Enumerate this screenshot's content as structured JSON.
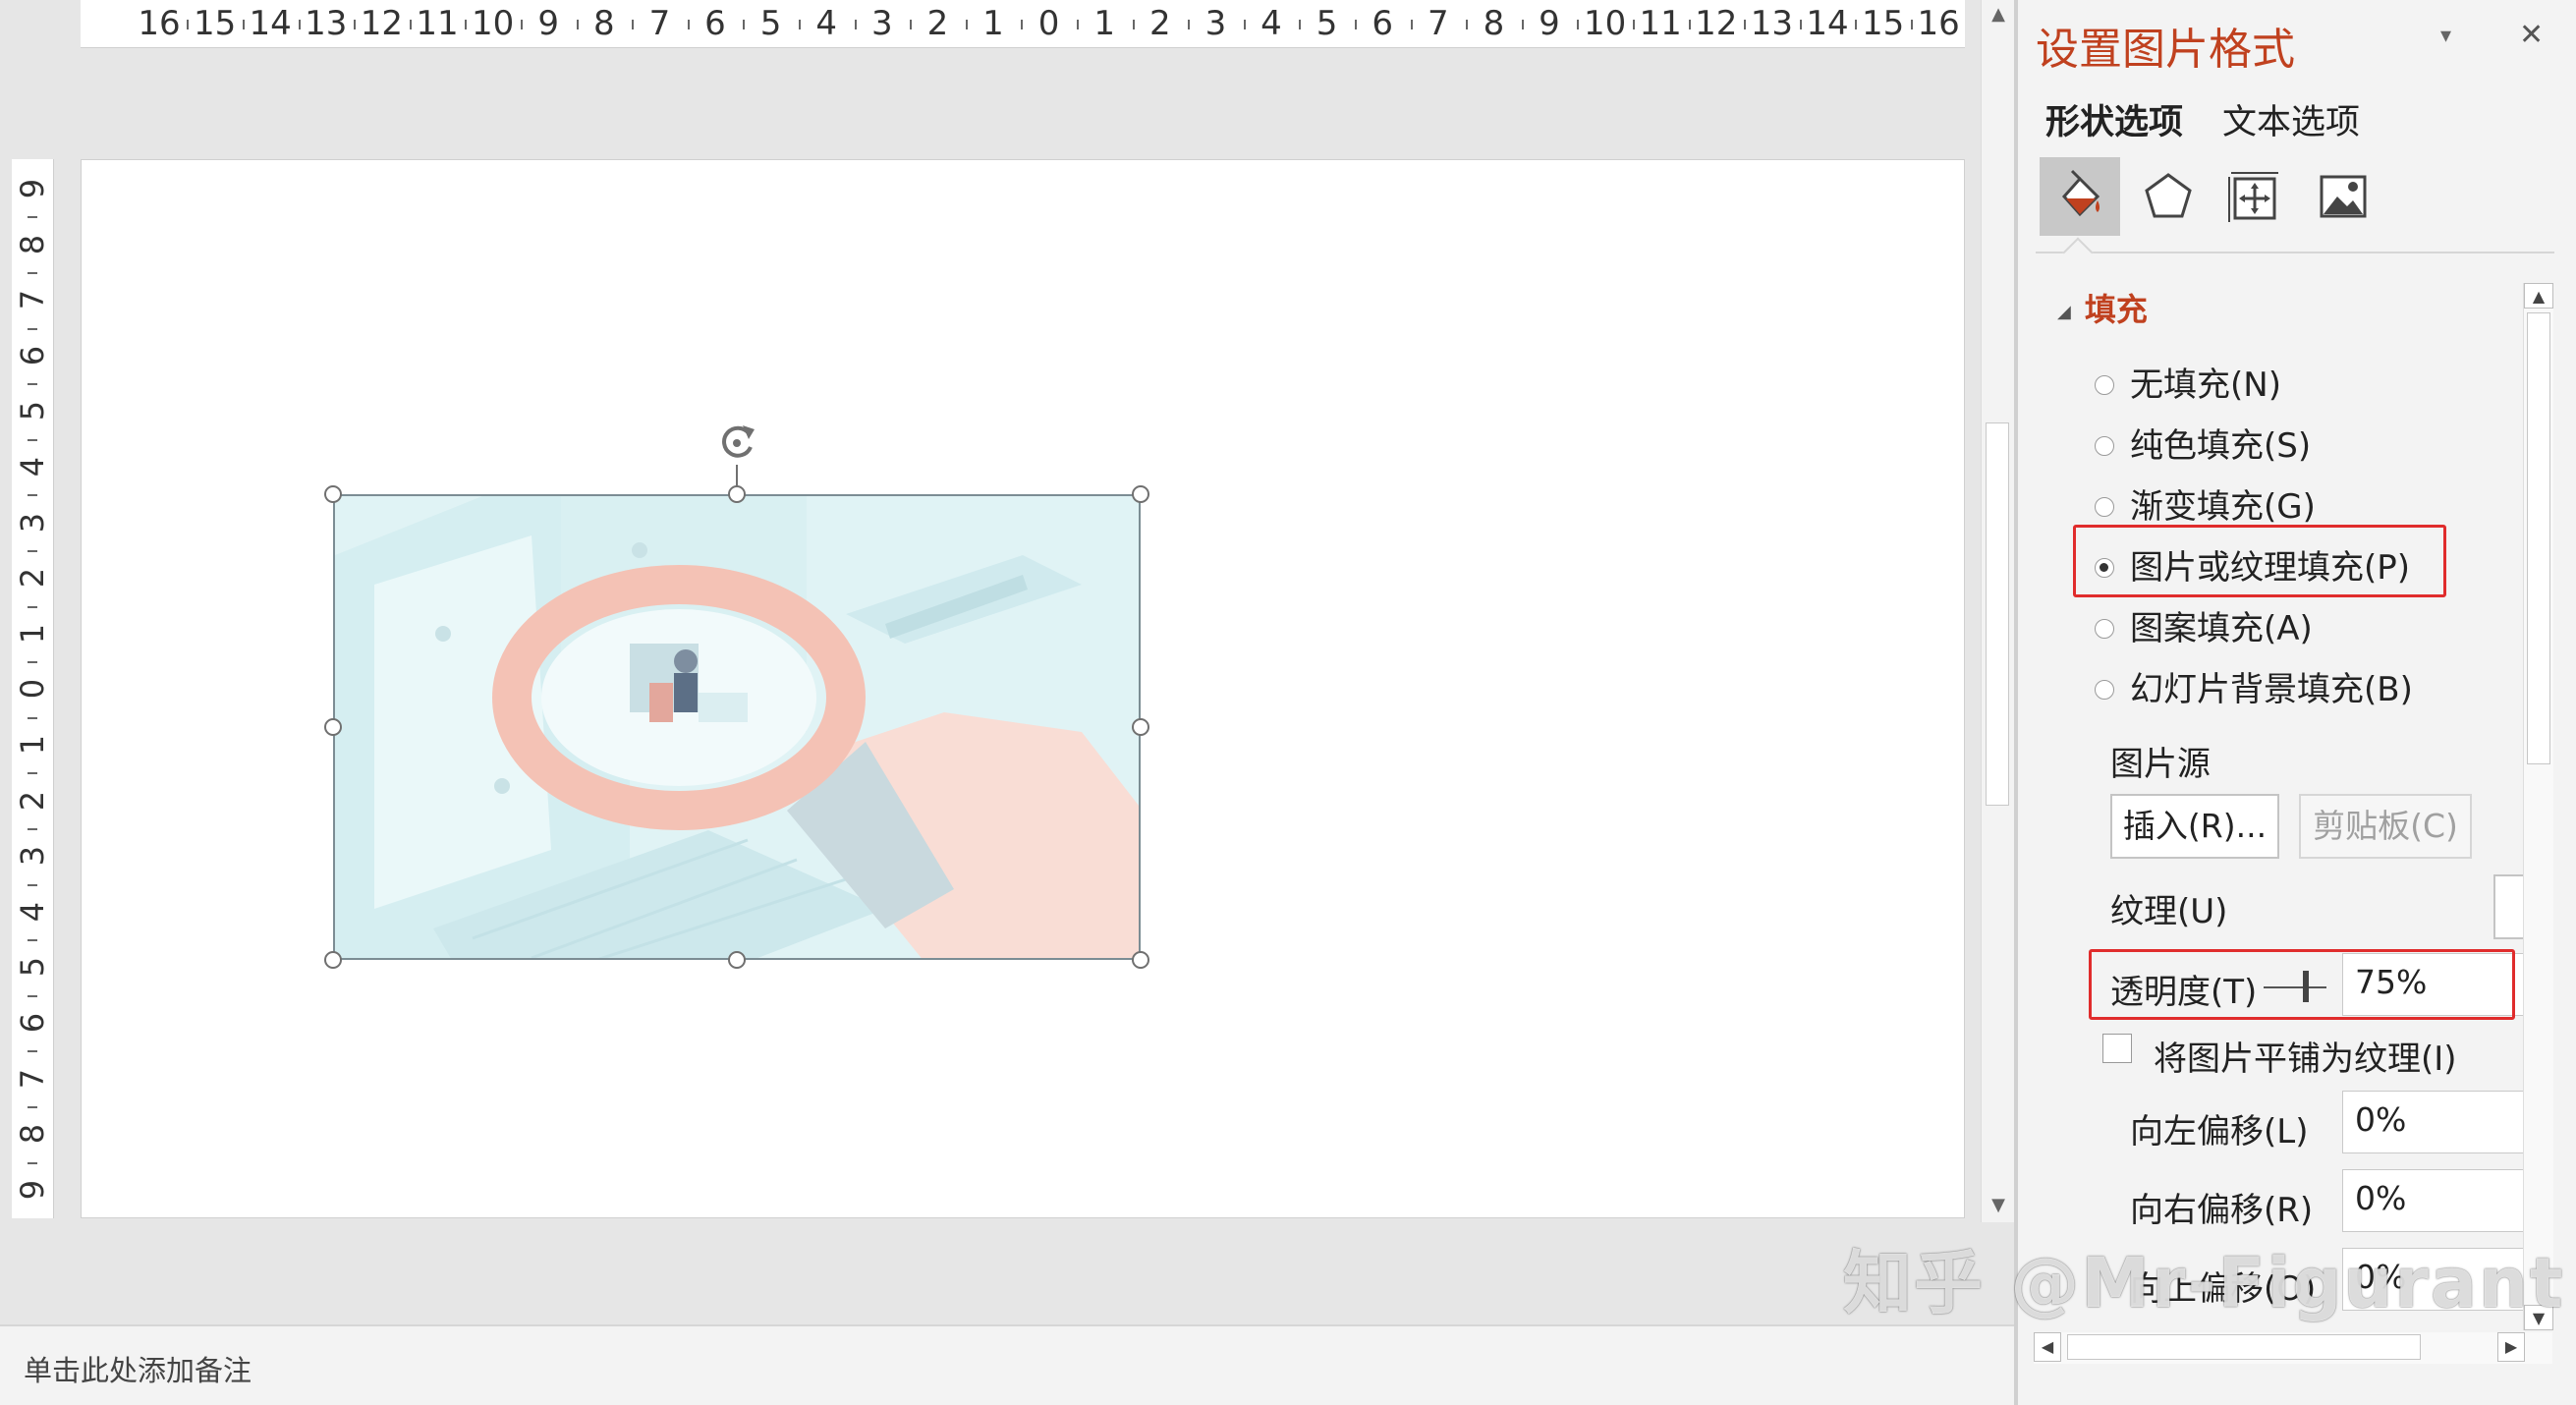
{
  "ruler": {
    "horizontal": [
      "16",
      "15",
      "14",
      "13",
      "12",
      "11",
      "10",
      "9",
      "8",
      "7",
      "6",
      "5",
      "4",
      "3",
      "2",
      "1",
      "0",
      "1",
      "2",
      "3",
      "4",
      "5",
      "6",
      "7",
      "8",
      "9",
      "10",
      "11",
      "12",
      "13",
      "14",
      "15",
      "16"
    ],
    "vertical": [
      "9",
      "8",
      "7",
      "6",
      "5",
      "4",
      "3",
      "2",
      "1",
      "0",
      "1",
      "2",
      "3",
      "4",
      "5",
      "6",
      "7",
      "8",
      "9"
    ]
  },
  "notes": {
    "placeholder": "单击此处添加备注"
  },
  "pane": {
    "title": "设置图片格式",
    "tabs": {
      "shape": "形状选项",
      "text": "文本选项"
    },
    "icons": [
      "fill-line-icon",
      "effects-icon",
      "size-properties-icon",
      "picture-icon"
    ],
    "section_fill": "填充",
    "fill_options": [
      {
        "label": "无填充(N)",
        "checked": false
      },
      {
        "label": "纯色填充(S)",
        "checked": false
      },
      {
        "label": "渐变填充(G)",
        "checked": false
      },
      {
        "label": "图片或纹理填充(P)",
        "checked": true
      },
      {
        "label": "图案填充(A)",
        "checked": false
      },
      {
        "label": "幻灯片背景填充(B)",
        "checked": false
      }
    ],
    "picture_source": "图片源",
    "insert_button": "插入(R)...",
    "clipboard_button": "剪贴板(C)",
    "texture_label": "纹理(U)",
    "transparency_label": "透明度(T)",
    "transparency_value": "75%",
    "tile_label": "将图片平铺为纹理(I)",
    "offset_left_label": "向左偏移(L)",
    "offset_left_value": "0%",
    "offset_right_label": "向右偏移(R)",
    "offset_right_value": "0%",
    "offset_up_label": "向上偏移(O)",
    "offset_up_value": "0%"
  },
  "watermark": "知乎 @Mr-Figurant",
  "colors": {
    "accent": "#c0411f",
    "highlight": "#e02c2c",
    "pane_bg": "#f3f3f3"
  }
}
